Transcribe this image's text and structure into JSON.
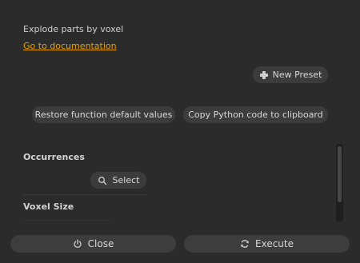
{
  "header": {
    "description": "Explode parts by voxel",
    "doc_link": "Go to documentation"
  },
  "presets": {
    "new_preset_label": "New Preset",
    "new_preset_icon": "plus-icon"
  },
  "actions": {
    "restore_label": "Restore function default values",
    "copy_python_label": "Copy Python code to clipboard"
  },
  "params": {
    "occurrences_label": "Occurrences",
    "select_label": "Select",
    "select_icon": "search-icon",
    "voxel_size_label": "Voxel Size"
  },
  "footer": {
    "close_label": "Close",
    "close_icon": "power-icon",
    "execute_label": "Execute",
    "execute_icon": "refresh-icon"
  },
  "colors": {
    "background": "#2b2b2b",
    "link": "#e8a100",
    "button": "#3c3c3c"
  }
}
